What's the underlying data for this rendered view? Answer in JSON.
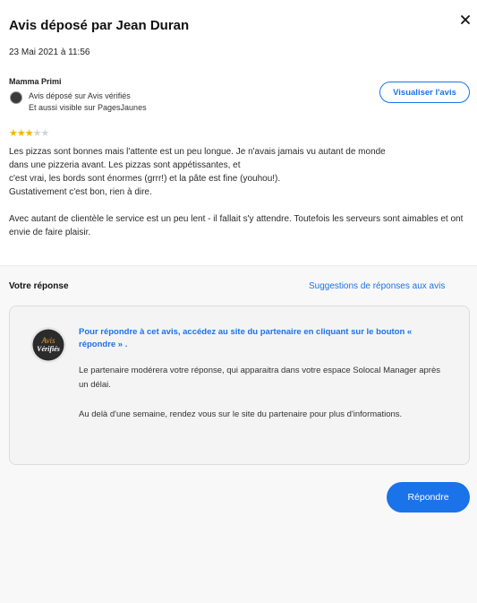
{
  "header": {
    "title": "Avis déposé par Jean Duran",
    "date": "23 Mai 2021 à 11:56"
  },
  "review": {
    "restaurant": "Mamma Primi",
    "source_line1": "Avis déposé sur Avis vérifiés",
    "source_line2": "Et aussi visible sur PagesJaunes",
    "view_button": "Visualiser l'avis",
    "rating": 3,
    "rating_max": 5,
    "star_color": "#f5b400",
    "lines": [
      "Les pizzas sont bonnes mais l'attente est un peu longue. Je n'avais jamais vu autant de monde",
      "dans une pizzeria avant. Les pizzas sont appétissantes, et",
      "c'est vrai, les bords sont énormes (grrr!) et la pâte est fine (youhou!).",
      "Gustativement c'est bon, rien à dire."
    ],
    "paragraph2": "Avec autant de clientèle le service est un peu lent - il fallait s'y attendre. Toutefois les serveurs sont aimables et ont envie de faire plaisir."
  },
  "response": {
    "label": "Votre réponse",
    "suggestions_link": "Suggestions de réponses aux avis",
    "info_highlight": "Pour répondre à cet avis, accédez au site du partenaire en cliquant sur le bouton « répondre » .",
    "info_text1": "Le partenaire modérera votre réponse, qui apparaitra dans votre espace Solocal Manager après un délai.",
    "info_text2": "Au delà d'une semaine, rendez vous sur le site du partenaire pour plus d'informations.",
    "logo_text_top": "Avis",
    "logo_text_bottom": "Vérifiés",
    "reply_button": "Répondre"
  },
  "colors": {
    "accent": "#1a73e8"
  }
}
